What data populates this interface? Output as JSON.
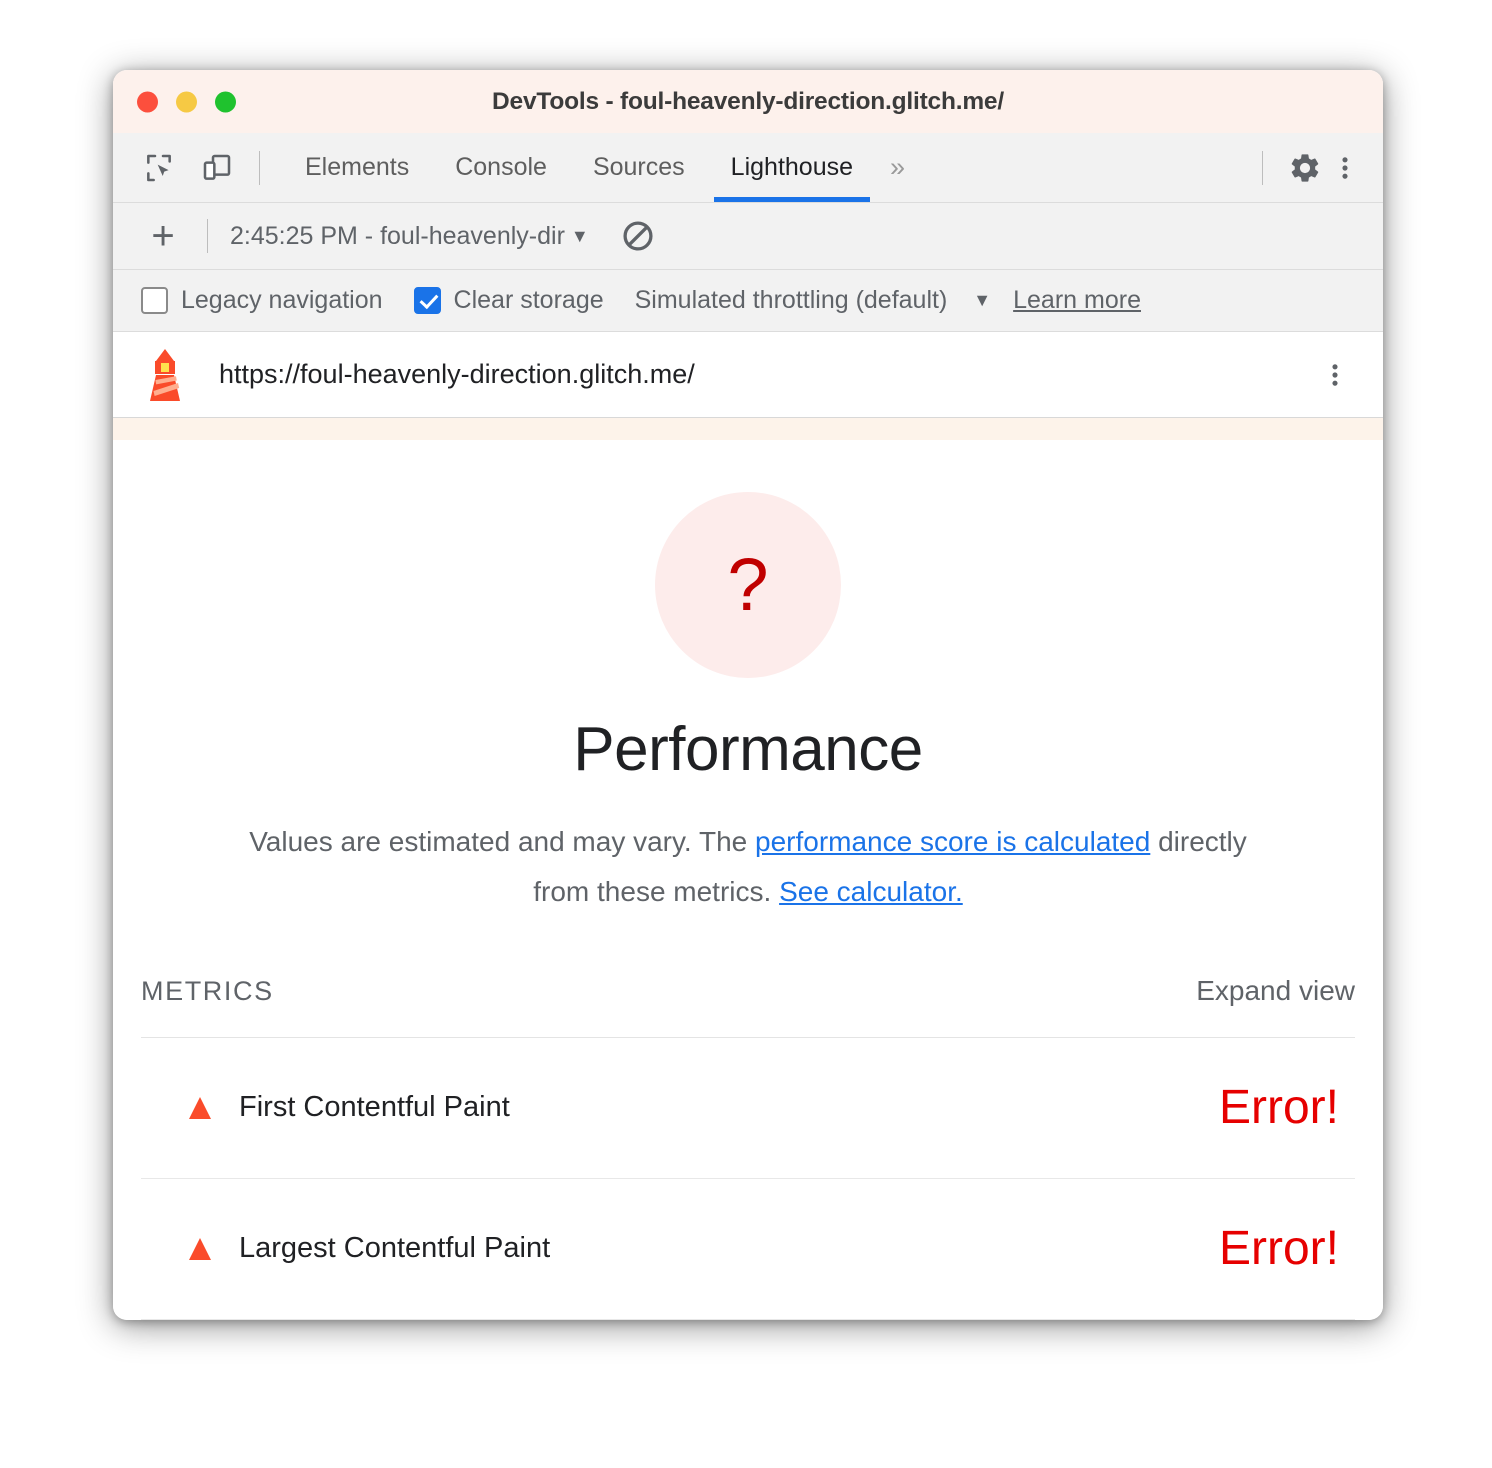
{
  "window": {
    "title": "DevTools - foul-heavenly-direction.glitch.me/",
    "traffic_lights": [
      "close-red",
      "minimize-yellow",
      "maximize-green"
    ]
  },
  "tabbar": {
    "inspect_icon": "inspect-element-icon",
    "device_icon": "device-toolbar-icon",
    "tabs": [
      {
        "label": "Elements",
        "active": false
      },
      {
        "label": "Console",
        "active": false
      },
      {
        "label": "Sources",
        "active": false
      },
      {
        "label": "Lighthouse",
        "active": true
      }
    ],
    "more_tabs": "»",
    "settings_icon": "gear-icon",
    "overflow_icon": "more-vertical-icon",
    "active_tab_underline_color": "#1a73e8"
  },
  "runbar": {
    "new_report_label": "+",
    "selected_run": "2:45:25 PM - foul-heavenly-dir",
    "caret": "▼",
    "clear_icon": "no-entry-clear-icon"
  },
  "options": {
    "legacy_navigation": {
      "label": "Legacy navigation",
      "checked": false
    },
    "clear_storage": {
      "label": "Clear storage",
      "checked": true
    },
    "throttling": {
      "label": "Simulated throttling (default)",
      "caret": "▼"
    },
    "learn_more": "Learn more"
  },
  "urlbar": {
    "logo": "lighthouse-icon",
    "url": "https://foul-heavenly-direction.glitch.me/",
    "menu_icon": "more-vertical-icon"
  },
  "report": {
    "gauge": {
      "value": "?",
      "fill_color": "#fdeceb",
      "text_color": "#c00000"
    },
    "category_title": "Performance",
    "description": {
      "lead": "Values are estimated and may vary. The ",
      "link1": "performance score is calculated",
      "middle": " directly from these metrics. ",
      "link2": "See calculator."
    },
    "metrics_section": {
      "heading": "METRICS",
      "expand_view": "Expand view",
      "rows": [
        {
          "icon": "error-triangle-icon",
          "name": "First Contentful Paint",
          "value": "Error!"
        },
        {
          "icon": "error-triangle-icon",
          "name": "Largest Contentful Paint",
          "value": "Error!"
        }
      ]
    }
  },
  "colors": {
    "accent_blue": "#1a73e8",
    "error_red": "#e60000",
    "warn_orange": "#fa4b2a",
    "titlebar_bg": "#fdf1ec"
  }
}
